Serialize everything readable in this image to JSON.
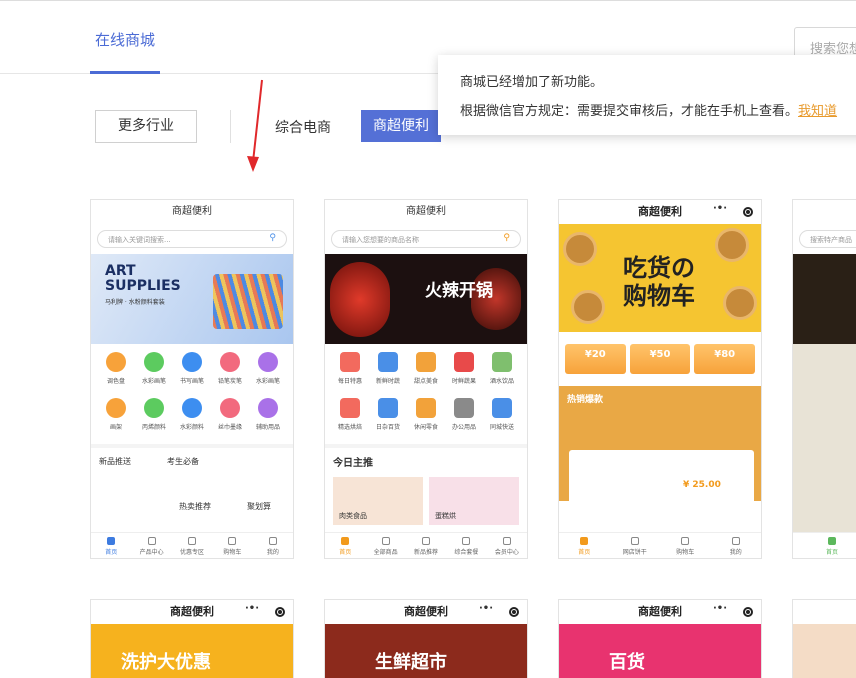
{
  "header": {
    "active_tab": "在线商城",
    "search_placeholder": "搜索您想"
  },
  "filters": {
    "more": "更多行业",
    "categories": [
      "综合电商",
      "商超便利"
    ]
  },
  "popup": {
    "line1": "商城已经增加了新功能。",
    "line2": "根据微信官方规定：需要提交审核后，才能在手机上查看。",
    "link": "我知道"
  },
  "cards": [
    {
      "title": "商超便利",
      "search": "请输入关键词搜索...",
      "banner_big": "ART\nSUPPLIES",
      "banner_sub": "马利牌 · 水粉颜料套装",
      "grid": [
        "调色盘",
        "水彩画笔",
        "书写画笔",
        "铅笔炭笔",
        "水彩画笔",
        "画架",
        "丙烯颜料",
        "水彩颜料",
        "丝巾墨缘",
        "辅助用品"
      ],
      "promos": [
        "新品推送",
        "考生必备",
        "热卖推荐",
        "聚划算"
      ],
      "tabs": [
        "首页",
        "产品中心",
        "优惠专区",
        "购物车",
        "我的"
      ]
    },
    {
      "title": "商超便利",
      "search": "请输入您想要的商品名称",
      "banner": "火辣开锅",
      "grid": [
        "每日特惠",
        "新鲜时蔬",
        "甜点美食",
        "时鲜蔬果",
        "酒水饮品",
        "精选烘焙",
        "日杂百货",
        "休闲零食",
        "办公用品",
        "同城快送"
      ],
      "section": "今日主推",
      "items": [
        "肉类食品",
        "蛋糕烘"
      ],
      "tabs": [
        "首页",
        "全部商品",
        "新品推荐",
        "综合套餐",
        "会员中心"
      ]
    },
    {
      "title": "商超便利",
      "banner": "吃货の\n购物车",
      "coupons": [
        "¥20",
        "¥50",
        "¥80"
      ],
      "hot": "热销爆款",
      "price": "¥ 25.00",
      "tabs": [
        "首页",
        "网店饼干",
        "购物车",
        "我的"
      ]
    },
    {
      "title": "",
      "search": "搜索特产商品",
      "tabs": [
        "首页"
      ]
    }
  ],
  "row2_titles": [
    "商超便利",
    "商超便利",
    "商超便利"
  ],
  "row2_banners": [
    "洗护大优惠",
    "生鲜超市",
    "百货"
  ]
}
